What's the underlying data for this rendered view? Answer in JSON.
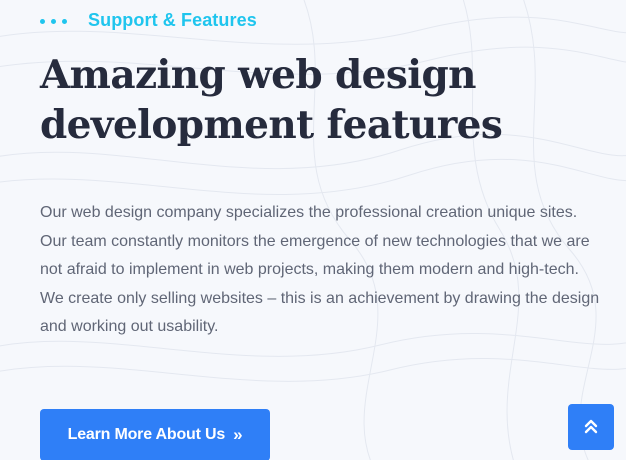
{
  "section": {
    "eyebrow": "Support & Features",
    "title_line1": "Amazing web design",
    "title_line2": "development features",
    "description": "Our web design company specializes the professional creation unique sites. Our team constantly monitors the emergence of new technologies that we are not afraid to implement in web projects, making them modern and high-tech. We create only selling websites – this is an achievement by drawing the design and working out usability."
  },
  "cta": {
    "label": "Learn More About Us",
    "icon": "double-chevron-right-icon"
  },
  "scroll_top": {
    "icon": "double-chevron-up-icon"
  },
  "colors": {
    "background": "#f6f8fc",
    "accent": "#1fc5ee",
    "primary_button": "#2f7ff7",
    "heading": "#262b3d",
    "body_text": "#606676"
  }
}
